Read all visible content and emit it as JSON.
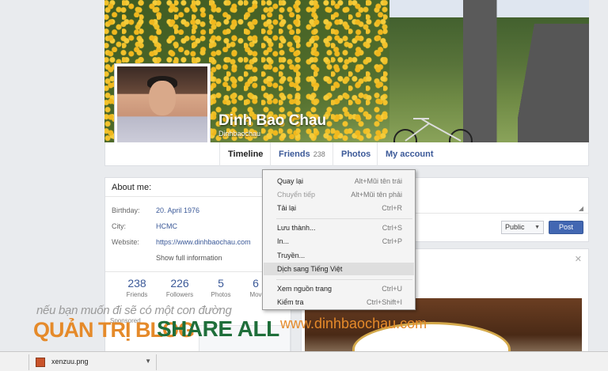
{
  "profile": {
    "name": "Dinh Bao Chau",
    "handle": "Dinhbaochau"
  },
  "tabs": [
    {
      "label": "Timeline",
      "active": true
    },
    {
      "label": "Friends",
      "count": "238"
    },
    {
      "label": "Photos"
    },
    {
      "label": "My account"
    }
  ],
  "about": {
    "title": "About me:",
    "rows": [
      {
        "label": "Birthday:",
        "value": "20. April 1976"
      },
      {
        "label": "City:",
        "value": "HCMC"
      },
      {
        "label": "Website:",
        "value": "https://www.dinhbaochau.com"
      }
    ],
    "show_more": "Show full information",
    "stats": [
      {
        "num": "238",
        "label": "Friends"
      },
      {
        "num": "226",
        "label": "Followers"
      },
      {
        "num": "5",
        "label": "Photos"
      },
      {
        "num": "6",
        "label": "Mov"
      }
    ],
    "sponsored": "Sponsored"
  },
  "composer": {
    "privacy": "Public",
    "post_label": "Post"
  },
  "context_menu": {
    "items": [
      {
        "label": "Quay lại",
        "key": "Alt+Mũi tên trái",
        "disabled": false
      },
      {
        "label": "Chuyển tiếp",
        "key": "Alt+Mũi tên phải",
        "disabled": true
      },
      {
        "label": "Tải lại",
        "key": "Ctrl+R",
        "disabled": false
      },
      {
        "label": "Lưu thành...",
        "key": "Ctrl+S",
        "disabled": false
      },
      {
        "label": "In...",
        "key": "Ctrl+P",
        "disabled": false
      },
      {
        "label": "Truyền...",
        "key": "",
        "disabled": false
      },
      {
        "label": "Dịch sang Tiếng Việt",
        "key": "",
        "disabled": false,
        "highlighted": true
      },
      {
        "label": "Xem nguồn trang",
        "key": "Ctrl+U",
        "disabled": false
      },
      {
        "label": "Kiểm tra",
        "key": "Ctrl+Shift+I",
        "disabled": false
      }
    ]
  },
  "watermark": {
    "line1": "nếu bạn muốn đi sẽ có một con đường",
    "brand1": "QUẢN TRỊ BLOG",
    "brand2": "SHARE ALL",
    "url": "www.dinhbaochau.com"
  },
  "download": {
    "filename": "xenzuu.png"
  },
  "colors": {
    "link": "#3b5998",
    "post_button": "#4267b2",
    "watermark_orange": "#e58a2a",
    "watermark_green": "#1f6e3a"
  }
}
